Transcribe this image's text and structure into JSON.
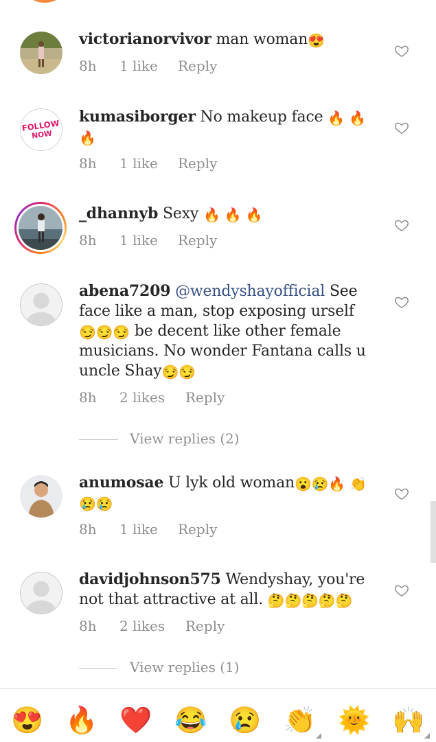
{
  "comments": [
    {
      "username": "victorianorvivor",
      "text": "man woman",
      "emoji": "😍",
      "time": "8h",
      "likes": "1 like",
      "reply": "Reply"
    },
    {
      "username": "kumasiborger",
      "text": "No makeup face",
      "emoji_line1": "🔥 🔥",
      "emoji_line2": "🔥",
      "avatar_text_1": "FOLLOW",
      "avatar_text_2": "NOW",
      "time": "8h",
      "likes": "1 like",
      "reply": "Reply"
    },
    {
      "username": "_dhannyb",
      "text": "Sexy",
      "emoji": "🔥 🔥 🔥",
      "time": "8h",
      "likes": "1 like",
      "reply": "Reply"
    },
    {
      "username": "abena7209",
      "mention": "@wendyshayofficial",
      "text_1": "See face like a man, stop exposing urself",
      "emoji_a": "😏😏😏",
      "text_2": "be decent like other female musicians. No wonder Fantana calls u uncle Shay",
      "emoji_b": "😏😏",
      "time": "8h",
      "likes": "2 likes",
      "reply": "Reply",
      "view_replies": "View replies (2)"
    },
    {
      "username": "anumosae",
      "text": "U lyk old woman",
      "emoji_line1": "😮😢🔥 👏",
      "emoji_line2": "😢😢",
      "time": "8h",
      "likes": "1 like",
      "reply": "Reply"
    },
    {
      "username": "davidjohnson575",
      "text": "Wendyshay, you're not that attractive at all.",
      "emoji": "🤔🤔🤔🤔🤔",
      "time": "8h",
      "likes": "2 likes",
      "reply": "Reply",
      "view_replies": "View replies (1)"
    }
  ],
  "emoji_bar": [
    "😍",
    "🔥",
    "❤️",
    "😂",
    "😢",
    "👏",
    "🌞",
    "🙌"
  ],
  "icons": {
    "heart": "heart-outline-icon",
    "avatar_default": "default-avatar-icon"
  }
}
